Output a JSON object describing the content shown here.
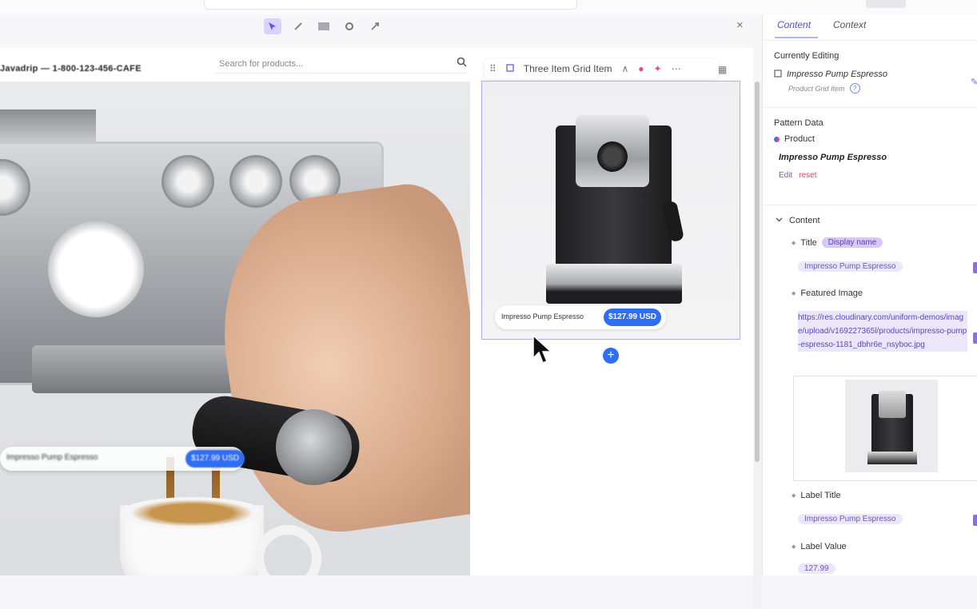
{
  "editor": {
    "toolbar_icons": [
      "select-icon",
      "comment-icon",
      "link-icon",
      "preview-icon",
      "settings-icon",
      "expand-icon"
    ],
    "close_icon": "×"
  },
  "site": {
    "logo_text": "Javadrip — 1-800-123-456-CAFE",
    "search_placeholder": "Search for products...",
    "hero_caption": {
      "name": "Impresso Pump Espresso",
      "price": "$127.99 USD"
    }
  },
  "component_toolbar": {
    "name": "Three Item Grid Item",
    "up_arrow": "∧",
    "more": "⋯"
  },
  "product_card": {
    "name": "Impresso Pump Espresso",
    "price": "$127.99 USD",
    "add_label": "+"
  },
  "panel": {
    "tabs": [
      "Content",
      "Context"
    ],
    "currently_editing_label": "Currently Editing",
    "current_item": "Impresso Pump Espresso",
    "current_type": "Product Grid Item",
    "help_label": "?",
    "pattern_data_label": "Pattern Data",
    "pattern_data_source": "Product",
    "pattern_product_name": "Impresso Pump Espresso",
    "edit_label": "Edit",
    "reset_label": "reset",
    "content_label": "Content",
    "fields": {
      "title_label": "Title",
      "title_chip": "Display name",
      "title_value": "Impresso Pump Espresso",
      "featured_image_label": "Featured Image",
      "featured_image_url": "https://res.cloudinary.com/uniform-demos/image/upload/v169227365l/products/impresso-pump-espresso-1181_dbhr6e_nsyboc.jpg",
      "label_title_label": "Label Title",
      "label_title_value": "Impresso Pump Espresso",
      "label_value_label": "Label Value",
      "label_value_value": "127.99"
    }
  }
}
